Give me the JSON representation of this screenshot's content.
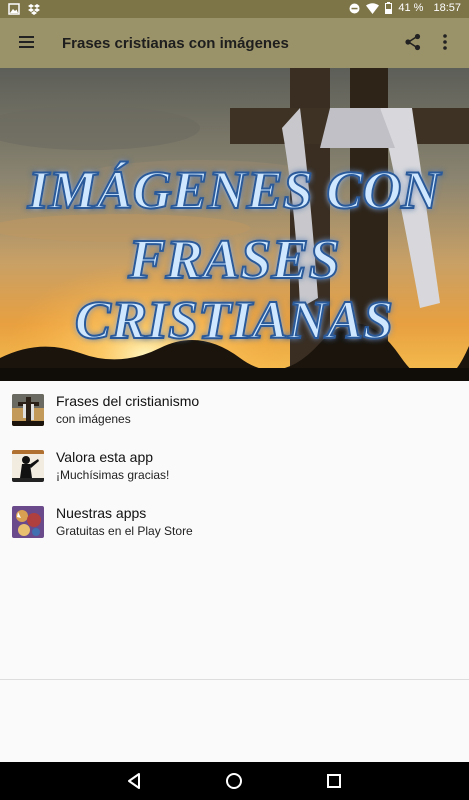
{
  "status_bar": {
    "battery_percent": "41 %",
    "time": "18:57"
  },
  "app_bar": {
    "title": "Frases cristianas con imágenes"
  },
  "banner": {
    "text_line1": "IMÁGENES CON",
    "text_line2": "FRASES",
    "text_line3": "CRISTIANAS"
  },
  "menu_items": [
    {
      "title": "Frases del cristianismo",
      "subtitle": "con imágenes"
    },
    {
      "title": "Valora esta app",
      "subtitle": "¡Muchísimas gracias!"
    },
    {
      "title": "Nuestras apps",
      "subtitle": "Gratuitas en el Play Store"
    }
  ],
  "colors": {
    "status_bar": "#7d7448",
    "app_bar": "#9a9268",
    "background": "#fafafa",
    "nav_bar": "#000000"
  }
}
